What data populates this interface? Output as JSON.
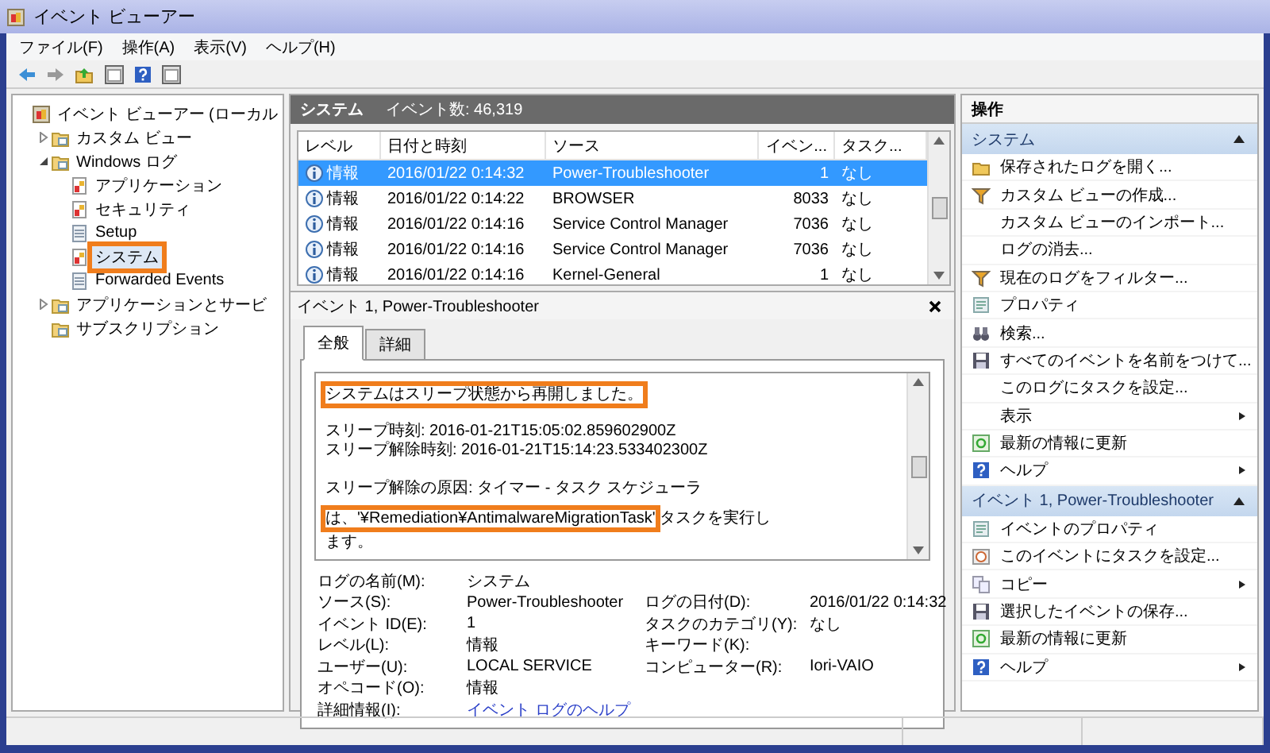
{
  "window": {
    "title": "イベント ビューアー"
  },
  "menu": [
    "ファイル(F)",
    "操作(A)",
    "表示(V)",
    "ヘルプ(H)"
  ],
  "tree": [
    {
      "label": "イベント ビューアー (ローカル",
      "kind": "root",
      "selected": false,
      "highlighted": false,
      "children": [
        {
          "label": "カスタム ビュー",
          "kind": "folder",
          "expanded": false,
          "selected": false,
          "highlighted": false
        },
        {
          "label": "Windows ログ",
          "kind": "folder",
          "expanded": true,
          "selected": false,
          "highlighted": false,
          "children": [
            {
              "label": "アプリケーション",
              "kind": "log",
              "selected": false,
              "highlighted": false
            },
            {
              "label": "セキュリティ",
              "kind": "log",
              "selected": false,
              "highlighted": false
            },
            {
              "label": "Setup",
              "kind": "plain",
              "selected": false,
              "highlighted": false
            },
            {
              "label": "システム",
              "kind": "log",
              "selected": true,
              "highlighted": true
            },
            {
              "label": "Forwarded Events",
              "kind": "plain",
              "selected": false,
              "highlighted": false
            }
          ]
        },
        {
          "label": "アプリケーションとサービ",
          "kind": "folder",
          "expanded": false,
          "selected": false,
          "highlighted": false
        },
        {
          "label": "サブスクリプション",
          "kind": "folder",
          "selected": false,
          "highlighted": false
        }
      ]
    }
  ],
  "log_header": {
    "name": "システム",
    "count": "イベント数: 46,319"
  },
  "table": {
    "columns": [
      "レベル",
      "日付と時刻",
      "ソース",
      "イベン...",
      "タスク..."
    ],
    "rows": [
      {
        "level": "情報",
        "date": "2016/01/22 0:14:32",
        "source": "Power-Troubleshooter",
        "event_id": "1",
        "task": "なし",
        "selected": true
      },
      {
        "level": "情報",
        "date": "2016/01/22 0:14:22",
        "source": "BROWSER",
        "event_id": "8033",
        "task": "なし",
        "selected": false
      },
      {
        "level": "情報",
        "date": "2016/01/22 0:14:16",
        "source": "Service Control Manager",
        "event_id": "7036",
        "task": "なし",
        "selected": false
      },
      {
        "level": "情報",
        "date": "2016/01/22 0:14:16",
        "source": "Service Control Manager",
        "event_id": "7036",
        "task": "なし",
        "selected": false
      },
      {
        "level": "情報",
        "date": "2016/01/22 0:14:16",
        "source": "Kernel-General",
        "event_id": "1",
        "task": "なし",
        "selected": false
      }
    ]
  },
  "detail": {
    "title": "イベント 1, Power-Troubleshooter",
    "tabs": [
      {
        "label": "全般",
        "selected": true
      },
      {
        "label": "詳細",
        "selected": false
      }
    ],
    "message": [
      [
        [
          {
            "text": "システムはスリープ状態から再開しました。",
            "highlighted": true
          }
        ]
      ],
      [
        [
          {
            "text": "スリープ時刻: 2016-01-21T15:05:02.859602900Z",
            "highlighted": false
          }
        ],
        [
          {
            "text": "スリープ解除時刻: 2016-01-21T15:14:23.533402300Z",
            "highlighted": false
          }
        ]
      ],
      [
        [
          {
            "text": "スリープ解除の原因: タイマー - タスク スケジューラ",
            "highlighted": false
          },
          {
            "text": "は、'¥Remediation¥AntimalwareMigrationTask'",
            "highlighted": true
          },
          {
            "text": " タスクを実行し",
            "highlighted": false
          }
        ],
        [
          {
            "text": "ます。",
            "highlighted": false
          }
        ]
      ]
    ],
    "fields": [
      [
        {
          "label": "ログの名前(M):",
          "value": "システム",
          "kind": "text"
        }
      ],
      [
        {
          "label": "ソース(S):",
          "value": "Power-Troubleshooter",
          "kind": "text"
        },
        {
          "label": "ログの日付(D):",
          "value": "2016/01/22 0:14:32",
          "kind": "text"
        }
      ],
      [
        {
          "label": "イベント ID(E):",
          "value": "1",
          "kind": "text"
        },
        {
          "label": "タスクのカテゴリ(Y):",
          "value": "なし",
          "kind": "text"
        }
      ],
      [
        {
          "label": "レベル(L):",
          "value": "情報",
          "kind": "text"
        },
        {
          "label": "キーワード(K):"
        }
      ],
      [
        {
          "label": "ユーザー(U):",
          "value": "LOCAL SERVICE",
          "kind": "text"
        },
        {
          "label": "コンピューター(R):",
          "value": "Iori-VAIO",
          "kind": "text"
        }
      ],
      [
        {
          "label": "オペコード(O):",
          "value": "情報",
          "kind": "text"
        }
      ],
      [
        {
          "label": "詳細情報(I):",
          "value": "イベント ログのヘルプ",
          "kind": "link"
        }
      ]
    ]
  },
  "actions": {
    "title": "操作",
    "sections": [
      {
        "title": "システム",
        "expanded": true,
        "items": [
          {
            "label": "保存されたログを開く...",
            "submenu": false
          },
          {
            "label": "カスタム ビューの作成...",
            "submenu": false
          },
          {
            "label": "カスタム ビューのインポート...",
            "submenu": false
          },
          {
            "label": "ログの消去...",
            "submenu": false
          },
          {
            "label": "現在のログをフィルター...",
            "submenu": false
          },
          {
            "label": "プロパティ",
            "submenu": false
          },
          {
            "label": "検索...",
            "submenu": false
          },
          {
            "label": "すべてのイベントを名前をつけて...",
            "submenu": false
          },
          {
            "label": "このログにタスクを設定...",
            "submenu": false
          },
          {
            "label": "表示",
            "submenu": true
          },
          {
            "label": "最新の情報に更新",
            "submenu": false
          },
          {
            "label": "ヘルプ",
            "submenu": true
          }
        ]
      },
      {
        "title": "イベント 1, Power-Troubleshooter",
        "expanded": true,
        "items": [
          {
            "label": "イベントのプロパティ",
            "submenu": false
          },
          {
            "label": "このイベントにタスクを設定...",
            "submenu": false
          },
          {
            "label": "コピー",
            "submenu": true
          },
          {
            "label": "選択したイベントの保存...",
            "submenu": false
          },
          {
            "label": "最新の情報に更新",
            "submenu": false
          },
          {
            "label": "ヘルプ",
            "submenu": true
          }
        ]
      }
    ]
  }
}
